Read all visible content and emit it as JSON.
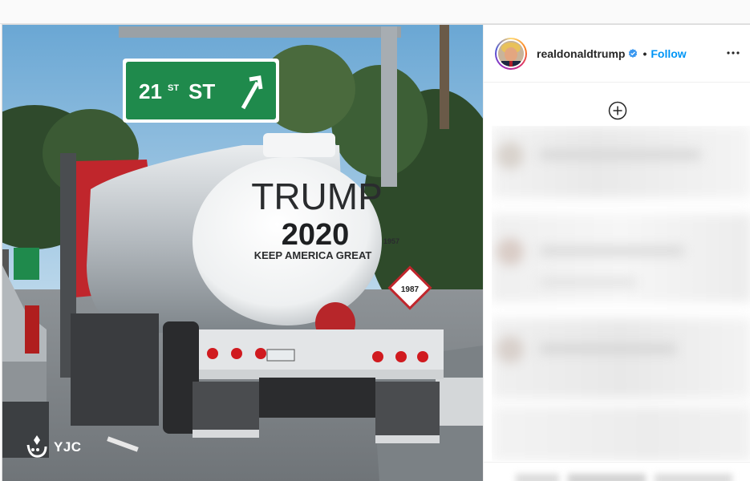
{
  "post": {
    "username": "realdonaldtrump",
    "separator": "•",
    "follow_label": "Follow"
  },
  "image": {
    "sign_text": "21 ST ST",
    "sign_part1": "21",
    "sign_part2": "ST",
    "sign_part3": "ST",
    "tank_line1": "TRUMP",
    "tank_line2": "2020",
    "tank_line3": "KEEP AMERICA GREAT",
    "tank_number": "1957",
    "placard_number": "1987",
    "watermark": "YJC"
  },
  "icons": {
    "verified": "verified-badge-icon",
    "more": "more-options-icon",
    "load_more": "plus-circle-icon",
    "watermark_logo": "yjc-logo-icon"
  },
  "colors": {
    "accent": "#0095f6",
    "sign_green": "#1f8a4c",
    "username": "#262626"
  }
}
